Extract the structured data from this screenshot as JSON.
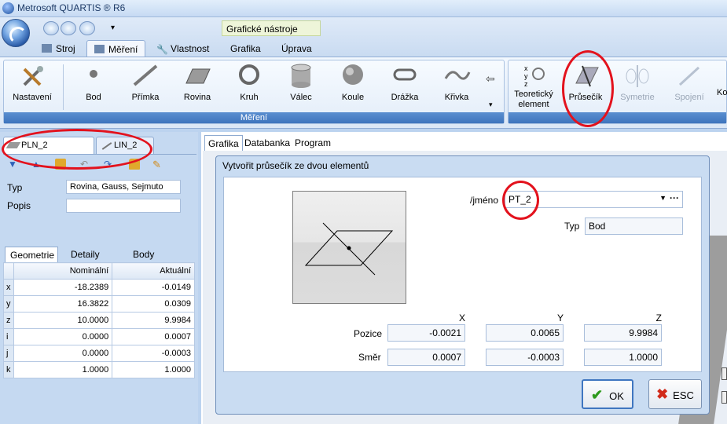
{
  "window": {
    "title": "Metrosoft QUARTIS ® R6"
  },
  "context_group": "Grafické nástroje",
  "ribbon_tabs": [
    "Stroj",
    "Měření",
    "Vlastnost",
    "Grafika",
    "Úprava"
  ],
  "ribbon_groups": {
    "mereni": "Měření"
  },
  "ribbon_buttons": {
    "nastaveni": "Nastavení",
    "bod": "Bod",
    "primka": "Přímka",
    "rovina": "Rovina",
    "kruh": "Kruh",
    "valec": "Válec",
    "koule": "Koule",
    "drazka": "Drážka",
    "krivka": "Křivka",
    "teoreticky_1": "Teoretický",
    "teoreticky_2": "element",
    "prusecik": "Průsečík",
    "symetrie": "Symetrie",
    "spojeni": "Spojení",
    "cut": "Ko"
  },
  "left_panel": {
    "tabs": [
      "PLN_2",
      "LIN_2"
    ],
    "typ_label": "Typ",
    "typ_value": "Rovina, Gauss, Sejmuto",
    "popis_label": "Popis",
    "popis_value": "",
    "subtabs": [
      "Geometrie",
      "Detaily",
      "Body"
    ],
    "table": {
      "headers": [
        "Nominální",
        "Aktuální"
      ],
      "rows": [
        {
          "k": "x",
          "nom": "-18.2389",
          "act": "-0.0149"
        },
        {
          "k": "y",
          "nom": "16.3822",
          "act": "0.0309"
        },
        {
          "k": "z",
          "nom": "10.0000",
          "act": "9.9984"
        },
        {
          "k": "i",
          "nom": "0.0000",
          "act": "0.0007"
        },
        {
          "k": "j",
          "nom": "0.0000",
          "act": "-0.0003"
        },
        {
          "k": "k",
          "nom": "1.0000",
          "act": "1.0000"
        }
      ]
    }
  },
  "right_tabs": [
    "Grafika",
    "Databanka",
    "Program"
  ],
  "dialog": {
    "title": "Vytvořit průsečík ze dvou elementů",
    "name_label": "/jméno",
    "name_value": "PT_2",
    "type_label": "Typ",
    "type_value": "Bod",
    "x_head": "X",
    "y_head": "Y",
    "z_head": "Z",
    "pozice_label": "Pozice",
    "smer_label": "Směr",
    "pozice": [
      "-0.0021",
      "0.0065",
      "9.9984"
    ],
    "smer": [
      "0.0007",
      "-0.0003",
      "1.0000"
    ],
    "ok": "OK",
    "esc": "ESC"
  }
}
